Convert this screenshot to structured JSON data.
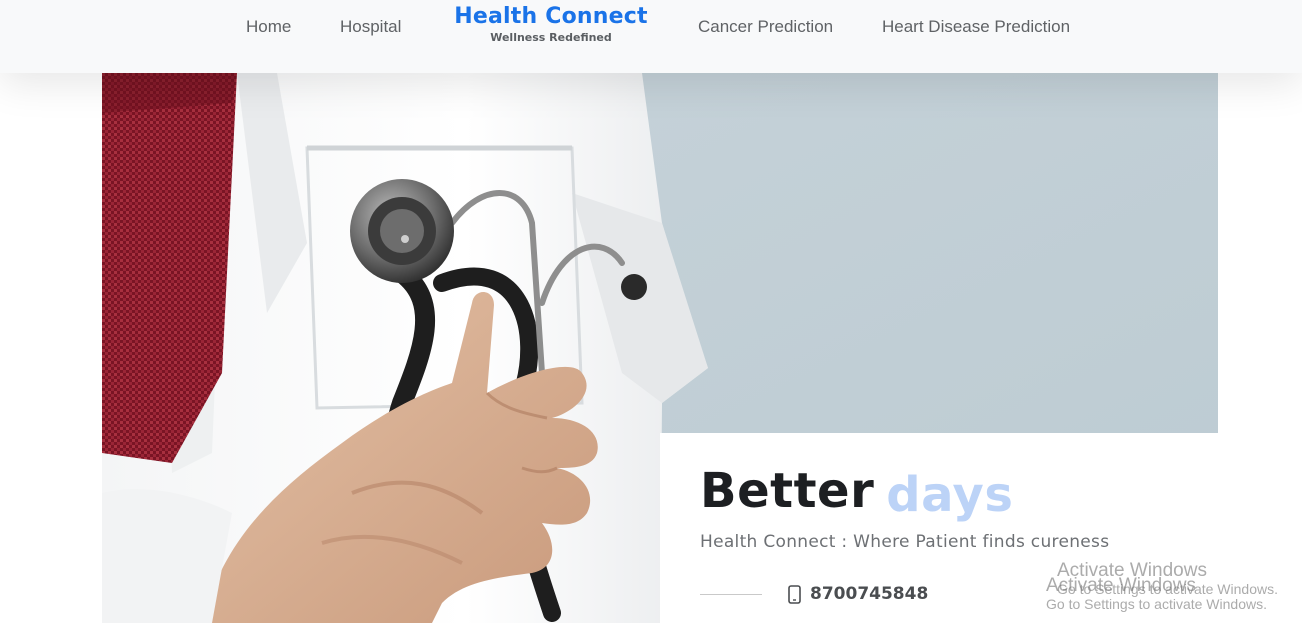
{
  "nav": {
    "links": [
      {
        "label": "Home"
      },
      {
        "label": "Hospital"
      },
      {
        "label": "Cancer Prediction"
      },
      {
        "label": "Heart Disease Prediction"
      }
    ],
    "brand": {
      "title": "Health Connect",
      "subtitle": "Wellness Redefined",
      "color": "#1a73e8"
    }
  },
  "hero": {
    "image": "doctor-with-stethoscope",
    "background_color": "#c1cfd6",
    "title_word_1": "Better",
    "title_word_2": "days",
    "title_word_2_color": "#bcd3f7",
    "subtitle": "Health Connect : Where Patient finds cureness",
    "phone": {
      "icon": "mobile-phone-icon",
      "number": "8700745848"
    }
  },
  "watermarks": [
    {
      "title": "Activate Windows",
      "body": "Go to Settings to activate Windows."
    },
    {
      "title": "Activate Windows",
      "body": "Go to Settings to activate Windows."
    }
  ]
}
